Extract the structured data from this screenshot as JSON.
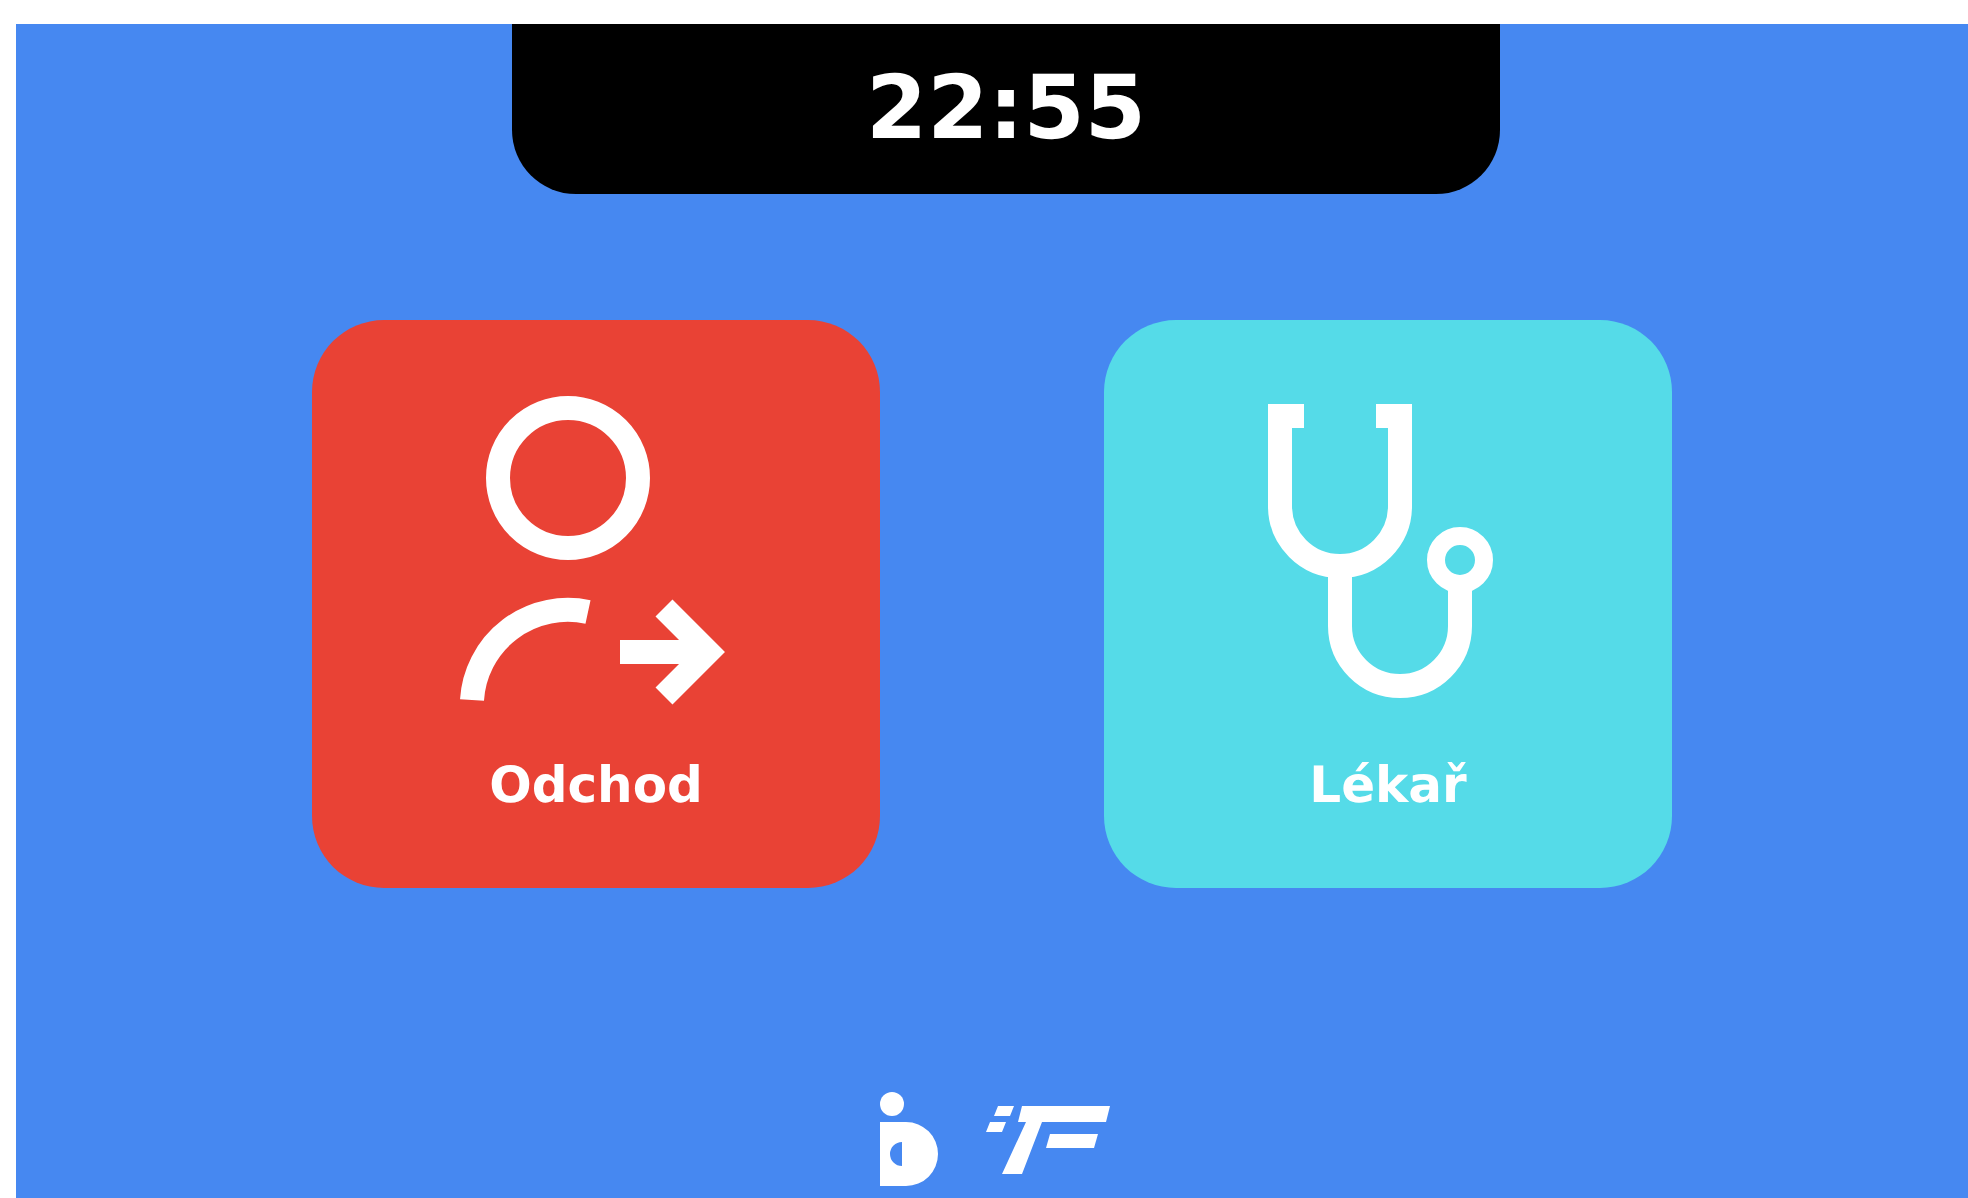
{
  "clock": {
    "time": "22:55"
  },
  "tiles": [
    {
      "kind": "leave",
      "label": "Odchod",
      "color": "#e94235"
    },
    {
      "kind": "doctor",
      "label": "Lékař",
      "color": "#55dbe8"
    }
  ]
}
